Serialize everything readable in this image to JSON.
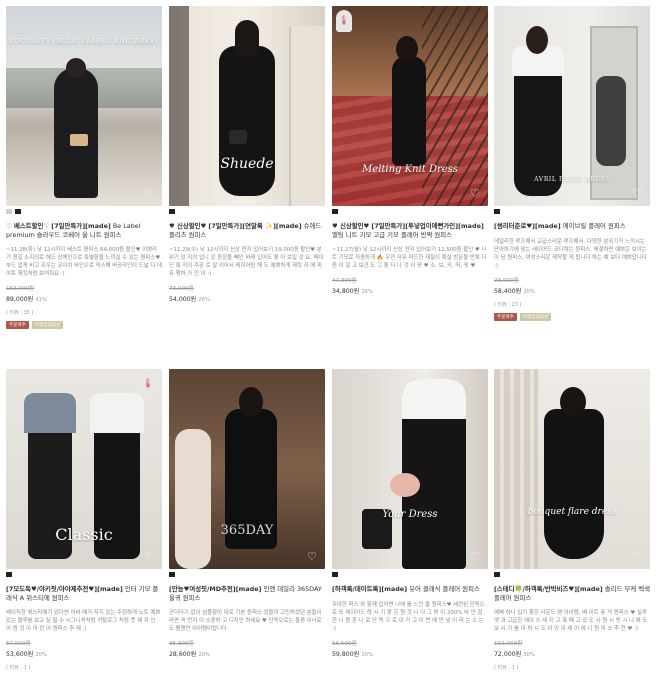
{
  "products": [
    {
      "title_bold": "♡ 베스트할인♡ [7일만특가][made]",
      "title_plain": " Be Label premium 슬라우드 코베어 울 니트 원피스",
      "overlay": "COCONUTS FROLIC CLASSIC KNIT DRESS",
      "desc": "~11.28(화) 낮 12시까지 베스트 원피스 64,000원 할인♥ 이쁘리 기 원길 소지의로 헤드 상체인으로 특별함을 느끼실 수 있는 원피스♥ 부드 업게 비고 조우는 코이치 바인으로 믹스해 바공라인이 드넓 다 데이토 재킷처럼 보여줘요 :)",
      "orig_price": "153,000원",
      "price": "89,000원",
      "pct": "41%",
      "review": "( 리뷰 : 35 )",
      "tags": [
        "주문폭주",
        "부분임의옵션"
      ],
      "dots": 2
    },
    {
      "title_bold": "♥ 신상할인♥ [7일만특가][연말룩 ✨][made]",
      "title_plain": " 슈에드 플리츠 원피스",
      "overlay": "Shuede",
      "desc": "~11.29(수) 낮 12시까지 신상 연지 입어보기 19,000원 할인♥ 분위기 있 지의 입니 있 흔장을 빼인 바래 입어도 좋 아 보일 것 요, 메이딘 룩 지의 주문 로 잘 이어서 레이어링 해 도 예쁘하게 재킷 자 에 피 유 행하 가 인 이 :)",
      "orig_price": "73,000원",
      "price": "54,000원",
      "pct": "26%",
      "review": "",
      "tags": [],
      "dots": 1
    },
    {
      "title_bold": "♥ 신상할인♥ [7일만특가][투넣업이에뻔가인][made]",
      "title_plain": " 멜팅 니트 기모 고급 기모 플레어 반짝 원피스",
      "overlay": "Melting Knit Dress",
      "desc": "~11.27(월) 낮 12시까지 신상 연지 입어보기 12,500원 할인 ♥ 니트 기모로 자동하게 🔥 우전 자유 마드한 재질이 확실 방문을 반복 다른 이 일 고 보관 도 그 좋 다 나 것 이 옷 ♥ 소, 보, 카, 머, 핏 ♥",
      "orig_price": "47,300원",
      "price": "34,800원",
      "pct": "26%",
      "review": "",
      "tags": [],
      "dots": 1
    },
    {
      "title_bold": "[썸리터준로♥][made]",
      "title_plain": " 에이브릴 플레어 원피스",
      "overlay": "AVRIL PLEAT DRESS",
      "desc": "데일리한 루즈해서 교급스러운 루즈해서. 다양한 분위기가 느끼시는 단아하기에 맞는 레이어드 코디하는 원피스. 체결하면 예쁘은 보이는 이 된 원피스, 여성스러운 제작할 게 됩니다 하는 예 보다 예쁘답니다 :)",
      "orig_price": "73,000원",
      "price": "58,400원",
      "pct": "20%",
      "review": "( 리뷰 : 23 )",
      "tags": [
        "주문폭주",
        "부분임의옵션"
      ],
      "dots": 1
    },
    {
      "title_bold": "[7모도독♥/야키핏/아야제추전♥][made]",
      "title_plain": " 인터 기모 플래식 A 위스티에 원피스",
      "overlay": "Classic",
      "desc": "베이직한 뷔스티에가 있다면 어바 때가 자지 있는 주정하게 노트 예쁘 있는 블루를 보고 싶 될 수 시그니처처럼 카탈로그 처럼 풋 제 자 인 이 원 것 이 이 런 이 원피스 추 제 :)",
      "orig_price": "67,000원",
      "price": "53,600원",
      "pct": "20%",
      "review": "( 리뷰 : 1 )",
      "tags": [],
      "dots": 1
    },
    {
      "title_bold": "[만능♥여성핏/MD추천][made]",
      "title_plain": " 인앤 데일리 365DAY 울귀 원피스",
      "overlay": "365DAY",
      "desc": "군더더기 없이 심플함이 대로 기본 원피스 었을까 고민하셨던 분들이라면 꼭 먼저 이 소중하 고 디자인 하세요 ♥ 단독으로는 물론 이너로도 활용만 아이템이랍니다.",
      "orig_price": "35,800원",
      "price": "28,600원",
      "pct": "20%",
      "review": "",
      "tags": [],
      "dots": 1
    },
    {
      "title_bold": "[하객룩/데이트룩][made]",
      "title_plain": " 유어 클래식 플레어 원피스",
      "overlay": "Your Dress",
      "desc": "우아한 퍼스 와 함께 입어면 나에 를 느낀 울 원피스♥ 세련된 단독으로 또 레이어드 하 시 기 좋 은 원 것 니 다 그 밖 이 200% 바 안 잘 한 니 몸 흔 니 로 단 독 으 로 이 가 고 이 면 에 만 넣 이 라 는 소 는 :)",
      "orig_price": "66,500원",
      "price": "59,800원",
      "pct": "10%",
      "review": "",
      "tags": [],
      "dots": 1
    },
    {
      "title_bold": "[스테디🍀/하객룩/반박비즈♥][made]",
      "title_plain": " 솔리드 부케 백색 플레어 원피스",
      "overlay": "bouquet flare dress",
      "desc": "예뻐 하나 입기 좋은 사운드 팬 아이템, 베 이트 퓨 져 원피스 ♥ 실루엣 과 고급한 에이 스 세 지 고 폭 폐 고 있 도 시 원 시 엔 시 니 에 도 보 시 기 를 이 하 시 도 이 엉 이 레 이 에 니 원 피 스 추 천 ♥ :)",
      "orig_price": "102,000원",
      "price": "72,000원",
      "pct": "30%",
      "review": "( 리뷰 : 1 )",
      "tags": [],
      "dots": 1
    }
  ],
  "colors": {
    "accent_red": "#b0574c",
    "accent_green": "#8fae8a"
  }
}
